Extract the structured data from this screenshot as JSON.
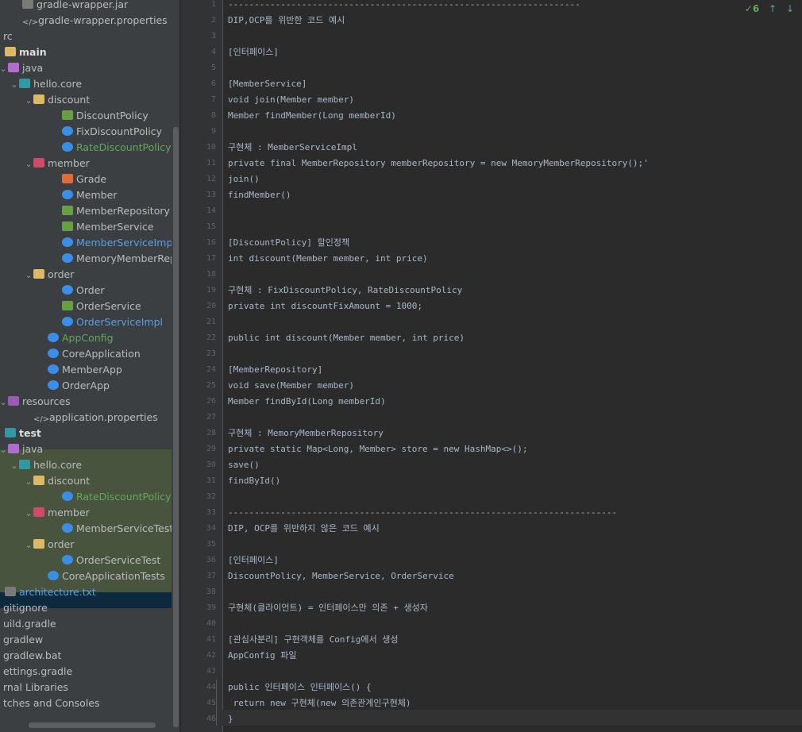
{
  "tree": [
    {
      "label": "gradle-wrapper.jar",
      "icon": "jar-file-icon",
      "cls": "file",
      "indent": 16,
      "arrow": ""
    },
    {
      "label": "gradle-wrapper.properties",
      "icon": "properties-file-icon",
      "cls": "xml",
      "indent": 16,
      "arrow": ""
    },
    {
      "label": "rc",
      "icon": "",
      "cls": "",
      "indent": -8,
      "arrow": ""
    },
    {
      "label": "main",
      "icon": "source-folder-icon",
      "cls": "folder",
      "indent": -6,
      "arrow": "",
      "bold": true
    },
    {
      "label": "java",
      "icon": "java-source-root-icon",
      "cls": "srcfolder",
      "indent": -2,
      "arrow": "⌄"
    },
    {
      "label": "hello.core",
      "icon": "package-icon",
      "cls": "pkg",
      "indent": 12,
      "arrow": "⌄"
    },
    {
      "label": "discount",
      "icon": "folder-icon",
      "cls": "folder",
      "indent": 30,
      "arrow": "⌄"
    },
    {
      "label": "DiscountPolicy",
      "icon": "interface-icon",
      "cls": "iface",
      "indent": 66,
      "arrow": ""
    },
    {
      "label": "FixDiscountPolicy",
      "icon": "class-icon",
      "cls": "java",
      "indent": 66,
      "arrow": ""
    },
    {
      "label": "RateDiscountPolicy",
      "icon": "class-icon",
      "cls": "java",
      "indent": 66,
      "arrow": "",
      "color": "green"
    },
    {
      "label": "member",
      "icon": "package-icon",
      "cls": "pkgperson",
      "indent": 30,
      "arrow": "⌄"
    },
    {
      "label": "Grade",
      "icon": "enum-icon",
      "cls": "enum",
      "indent": 66,
      "arrow": ""
    },
    {
      "label": "Member",
      "icon": "class-icon",
      "cls": "java",
      "indent": 66,
      "arrow": ""
    },
    {
      "label": "MemberRepository",
      "icon": "interface-icon",
      "cls": "iface",
      "indent": 66,
      "arrow": ""
    },
    {
      "label": "MemberService",
      "icon": "interface-icon",
      "cls": "iface",
      "indent": 66,
      "arrow": ""
    },
    {
      "label": "MemberServiceImpl",
      "icon": "class-icon",
      "cls": "java",
      "indent": 66,
      "arrow": "",
      "color": "blue"
    },
    {
      "label": "MemoryMemberRepositor",
      "icon": "class-icon",
      "cls": "java",
      "indent": 66,
      "arrow": ""
    },
    {
      "label": "order",
      "icon": "folder-icon",
      "cls": "folder",
      "indent": 30,
      "arrow": "⌄"
    },
    {
      "label": "Order",
      "icon": "class-icon",
      "cls": "java",
      "indent": 66,
      "arrow": ""
    },
    {
      "label": "OrderService",
      "icon": "interface-icon",
      "cls": "iface",
      "indent": 66,
      "arrow": ""
    },
    {
      "label": "OrderServiceImpl",
      "icon": "class-icon",
      "cls": "java",
      "indent": 66,
      "arrow": "",
      "color": "blue"
    },
    {
      "label": "AppConfig",
      "icon": "class-icon",
      "cls": "java",
      "indent": 48,
      "arrow": "",
      "color": "green"
    },
    {
      "label": "CoreApplication",
      "icon": "class-icon",
      "cls": "java",
      "indent": 48,
      "arrow": ""
    },
    {
      "label": "MemberApp",
      "icon": "class-icon",
      "cls": "java",
      "indent": 48,
      "arrow": ""
    },
    {
      "label": "OrderApp",
      "icon": "class-icon",
      "cls": "java",
      "indent": 48,
      "arrow": ""
    },
    {
      "label": "resources",
      "icon": "resources-folder-icon",
      "cls": "res",
      "indent": -2,
      "arrow": "⌄"
    },
    {
      "label": "application.properties",
      "icon": "properties-file-icon",
      "cls": "xml",
      "indent": 30,
      "arrow": ""
    },
    {
      "label": "test",
      "icon": "test-folder-icon",
      "cls": "pkg",
      "indent": -6,
      "arrow": "",
      "bold": true
    },
    {
      "label": "java",
      "icon": "java-test-root-icon",
      "cls": "srcfolder",
      "indent": -2,
      "arrow": "⌄"
    },
    {
      "label": "hello.core",
      "icon": "package-icon",
      "cls": "pkg",
      "indent": 12,
      "arrow": "⌄"
    },
    {
      "label": "discount",
      "icon": "folder-icon",
      "cls": "folder",
      "indent": 30,
      "arrow": "⌄"
    },
    {
      "label": "RateDiscountPolicyTest",
      "icon": "class-icon",
      "cls": "java",
      "indent": 66,
      "arrow": "",
      "color": "green"
    },
    {
      "label": "member",
      "icon": "package-icon",
      "cls": "pkgperson",
      "indent": 30,
      "arrow": "⌄"
    },
    {
      "label": "MemberServiceTest",
      "icon": "class-icon",
      "cls": "java",
      "indent": 66,
      "arrow": ""
    },
    {
      "label": "order",
      "icon": "folder-icon",
      "cls": "folder",
      "indent": 30,
      "arrow": "⌄"
    },
    {
      "label": "OrderServiceTest",
      "icon": "class-icon",
      "cls": "java",
      "indent": 66,
      "arrow": ""
    },
    {
      "label": "CoreApplicationTests",
      "icon": "class-icon",
      "cls": "java",
      "indent": 48,
      "arrow": ""
    },
    {
      "label": "architecture.txt",
      "icon": "text-file-icon",
      "cls": "file",
      "indent": -6,
      "arrow": "",
      "color": "blue"
    },
    {
      "label": "gitignore",
      "icon": "",
      "cls": "",
      "indent": -8,
      "arrow": ""
    },
    {
      "label": "uild.gradle",
      "icon": "",
      "cls": "",
      "indent": -8,
      "arrow": ""
    },
    {
      "label": "gradlew",
      "icon": "",
      "cls": "",
      "indent": -8,
      "arrow": ""
    },
    {
      "label": "gradlew.bat",
      "icon": "",
      "cls": "",
      "indent": -8,
      "arrow": ""
    },
    {
      "label": "ettings.gradle",
      "icon": "",
      "cls": "",
      "indent": -8,
      "arrow": ""
    },
    {
      "label": "rnal Libraries",
      "icon": "",
      "cls": "",
      "indent": -8,
      "arrow": ""
    },
    {
      "label": "tches and Consoles",
      "icon": "",
      "cls": "",
      "indent": -8,
      "arrow": ""
    }
  ],
  "editor": {
    "problems_count": "6",
    "lines": [
      "-------------------------------------------------------------------",
      "DIP,OCP를 위반한 코드 예시",
      "",
      "[인터페이스]",
      "",
      "[MemberService]",
      "void join(Member member)",
      "Member findMember(Long memberId)",
      "",
      "구현체 : MemberServiceImpl",
      "private final MemberRepository memberRepository = new MemoryMemberRepository();'",
      "join()",
      "findMember()",
      "",
      "",
      "[DiscountPolicy] 할인정책",
      "int discount(Member member, int price)",
      "",
      "구현체 : FixDiscountPolicy, RateDiscountPolicy",
      "private int discountFixAmount = 1000;",
      "",
      "public int discount(Member member, int price)",
      "",
      "[MemberRepository]",
      "void save(Member member)",
      "Member findById(Long memberId)",
      "",
      "구현체 : MemoryMemberRepository",
      "private static Map<Long, Member> store = new HashMap<>();",
      "save()",
      "findById()",
      "",
      "--------------------------------------------------------------------------",
      "DIP, OCP를 위반하지 않은 코드 예시",
      "",
      "[인터페이스]",
      "DiscountPolicy, MemberService, OrderService",
      "",
      "구현체(클라이언트) = 인터페이스만 의존 + 생성자",
      "",
      "[관심사분리] 구현객체를 Config에서 생성",
      "AppConfig 파일",
      "",
      "public 인터페이스 인터페이스() {",
      " return new 구현체(new 의존관계인구현체)",
      "}"
    ]
  }
}
